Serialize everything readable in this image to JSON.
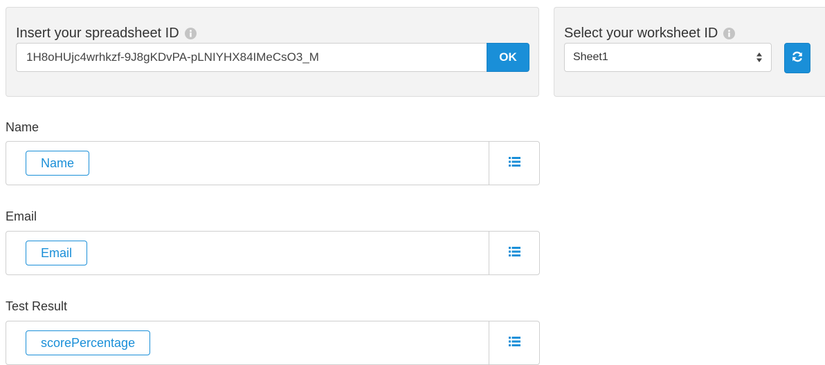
{
  "spreadsheet": {
    "label": "Insert your spreadsheet ID",
    "value": "1H8oHUjc4wrhkzf-9J8gKDvPA-pLNIYHX84IMeCsO3_M",
    "ok_label": "OK"
  },
  "worksheet": {
    "label": "Select your worksheet ID",
    "selected": "Sheet1"
  },
  "fields": [
    {
      "label": "Name",
      "tag": "Name"
    },
    {
      "label": "Email",
      "tag": "Email"
    },
    {
      "label": "Test Result",
      "tag": "scorePercentage"
    }
  ],
  "colors": {
    "accent": "#1a8fd8",
    "panel_bg": "#f3f3f3",
    "info_icon": "#c4c4c4"
  },
  "icons": {
    "info": "info-circle-icon",
    "select": "select-arrows-icon",
    "refresh": "refresh-icon",
    "list": "list-icon"
  }
}
